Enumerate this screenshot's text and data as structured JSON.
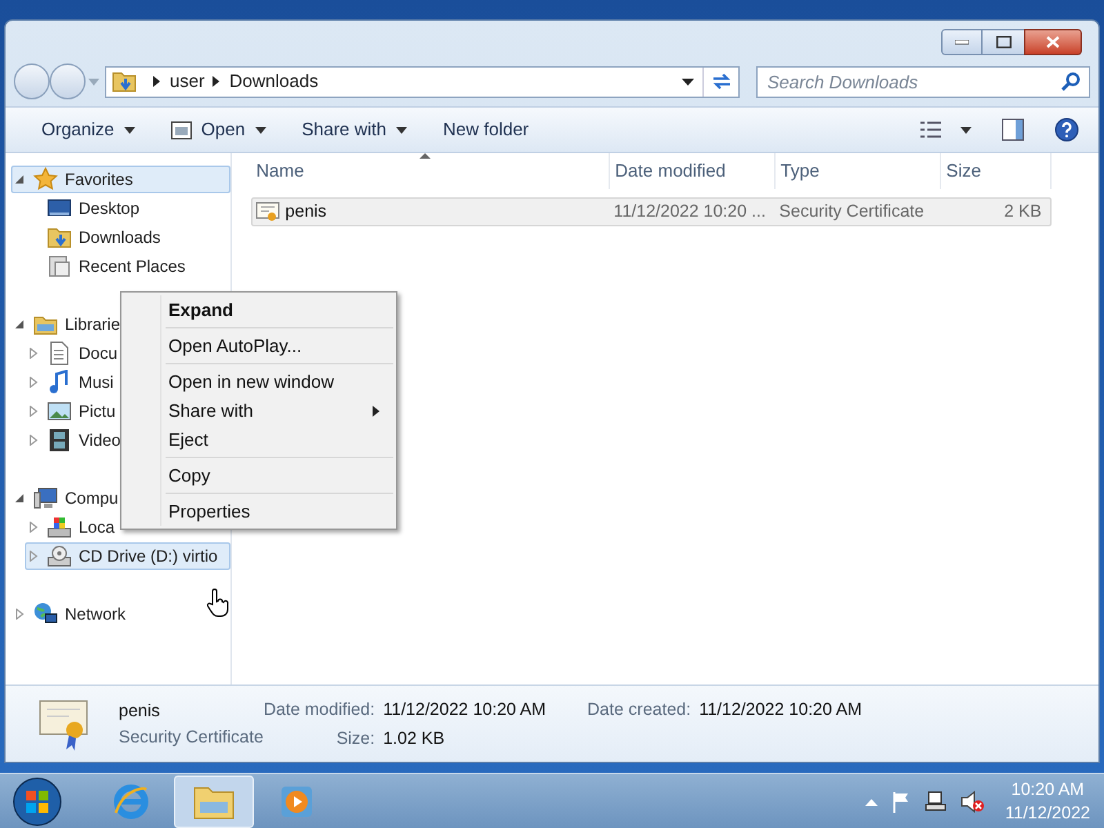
{
  "address": {
    "crumbs": [
      "user",
      "Downloads"
    ]
  },
  "search": {
    "placeholder": "Search Downloads"
  },
  "toolbar": [
    {
      "label": "Organize",
      "dropdown": true
    },
    {
      "label": "Open",
      "dropdown": true,
      "kind": "open"
    },
    {
      "label": "Share with",
      "dropdown": true
    },
    {
      "label": "New folder",
      "dropdown": false
    }
  ],
  "nav_tree": [
    {
      "label": "Favorites",
      "kind": "star",
      "expanded": true,
      "selected": true,
      "children": [
        {
          "label": "Desktop",
          "kind": "desktop",
          "selected": false
        },
        {
          "label": "Downloads",
          "kind": "downloads",
          "selected": false
        },
        {
          "label": "Recent Places",
          "kind": "recent",
          "selected": false
        }
      ]
    },
    {
      "label": "Librarie",
      "kind": "library",
      "expanded": true,
      "selected": false,
      "children": [
        {
          "label": "Docu",
          "kind": "document",
          "expanded": false,
          "selected": false
        },
        {
          "label": "Musi",
          "kind": "music",
          "expanded": false,
          "selected": false
        },
        {
          "label": "Pictu",
          "kind": "picture",
          "expanded": false,
          "selected": false
        },
        {
          "label": "Video",
          "kind": "video",
          "expanded": false,
          "selected": false
        }
      ]
    },
    {
      "label": "Compu",
      "kind": "computer",
      "expanded": true,
      "selected": false,
      "children": [
        {
          "label": "Loca",
          "kind": "drive",
          "expanded": false,
          "selected": false
        },
        {
          "label": "CD Drive (D:) virtio",
          "kind": "cd",
          "expanded": false,
          "selected": true
        }
      ]
    },
    {
      "label": "Network",
      "kind": "network",
      "expanded": false,
      "selected": false
    }
  ],
  "table": {
    "columns": [
      "Name",
      "Date modified",
      "Type",
      "Size"
    ],
    "rows": [
      {
        "name": "penis",
        "date_modified": "11/12/2022 10:20 ...",
        "type": "Security Certificate",
        "size": "2 KB",
        "selected": true
      }
    ]
  },
  "context_menu": [
    {
      "kind": "item",
      "label": "Expand",
      "default": true,
      "submenu": false
    },
    {
      "kind": "separator"
    },
    {
      "kind": "item",
      "label": "Open AutoPlay...",
      "default": false,
      "submenu": false
    },
    {
      "kind": "separator"
    },
    {
      "kind": "item",
      "label": "Open in new window",
      "default": false,
      "submenu": false
    },
    {
      "kind": "item",
      "label": "Share with",
      "default": false,
      "submenu": true
    },
    {
      "kind": "item",
      "label": "Eject",
      "default": false,
      "submenu": false
    },
    {
      "kind": "separator"
    },
    {
      "kind": "item",
      "label": "Copy",
      "default": false,
      "submenu": false
    },
    {
      "kind": "separator"
    },
    {
      "kind": "item",
      "label": "Properties",
      "default": false,
      "submenu": false
    }
  ],
  "details": {
    "name": "penis",
    "type": "Security Certificate",
    "fields": [
      {
        "label": "Date modified:",
        "value": "11/12/2022 10:20 AM"
      },
      {
        "label": "Date created:",
        "value": "11/12/2022 10:20 AM"
      },
      {
        "label": "Size:",
        "value": "1.02 KB"
      }
    ]
  },
  "taskbar": {
    "apps": [
      {
        "kind": "ie",
        "selected": false
      },
      {
        "kind": "explorer",
        "selected": true
      },
      {
        "kind": "media",
        "selected": false
      }
    ],
    "clock": {
      "time": "10:20 AM",
      "date": "11/12/2022"
    }
  }
}
